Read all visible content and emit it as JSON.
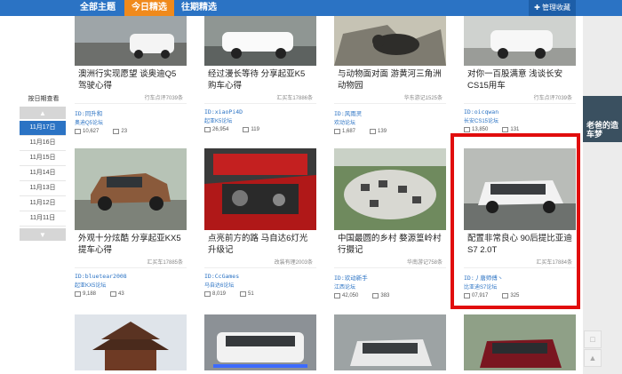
{
  "tabs": [
    "全部主题",
    "今日精选",
    "往期精选"
  ],
  "fav_label": "管理收藏",
  "sidebar": {
    "title": "按日期查看",
    "dates": [
      "11月17日",
      "11月16日",
      "11月15日",
      "11月14日",
      "11月13日",
      "11月12日",
      "11月11日"
    ]
  },
  "ad": {
    "text": "老爸的造车梦"
  },
  "cards_top": [
    {
      "title": "澳洲行实现愿望 谈奥迪Q5驾驶心得",
      "source": "行车点评7039条",
      "user": "ID:同升和",
      "forum": "奥迪Q5论坛",
      "views": "10,627",
      "replies": "23"
    },
    {
      "title": "经过漫长等待 分享起亚K5购车心得",
      "source": "汇买车17886条",
      "user": "ID:xiaoPi4D",
      "forum": "起亚K5论坛",
      "views": "26,954",
      "replies": "119"
    },
    {
      "title": "与动物面对面 游黄河三角洲动物园",
      "source": "华东游记1525条",
      "user": "ID:风雨灵",
      "forum": "欢动论坛",
      "views": "1,687",
      "replies": "139"
    },
    {
      "title": "对你一百股满意 浅谈长安CS15用车",
      "source": "行车点评7039条",
      "user": "ID:oicqwan",
      "forum": "长安CS15论坛",
      "views": "13,850",
      "replies": "131"
    }
  ],
  "cards_mid": [
    {
      "title": "外观十分炫酷 分享起亚KX5提车心得",
      "source": "汇买车17885条",
      "user": "ID:bluetear2008",
      "forum": "起亚KX5论坛",
      "views": "9,188",
      "replies": "43"
    },
    {
      "title": "点亮前方的路 马自达6灯光升级记",
      "source": "改装有理2003条",
      "user": "ID:CcGames",
      "forum": "马自达6论坛",
      "views": "8,019",
      "replies": "51"
    },
    {
      "title": "中国最圆的乡村 婺源篁岭村行摄记",
      "source": "华南游记758条",
      "user": "ID:欢动新手",
      "forum": "江西论坛",
      "views": "42,050",
      "replies": "383"
    },
    {
      "title": "配置非常良心 90后提比亚迪S7 2.0T",
      "source": "汇买车17884条",
      "user": "ID:丿唐师傅丶",
      "forum": "比亚迪S7论坛",
      "views": "07,917",
      "replies": "325"
    }
  ],
  "right_tools": [
    "□",
    "▲"
  ]
}
